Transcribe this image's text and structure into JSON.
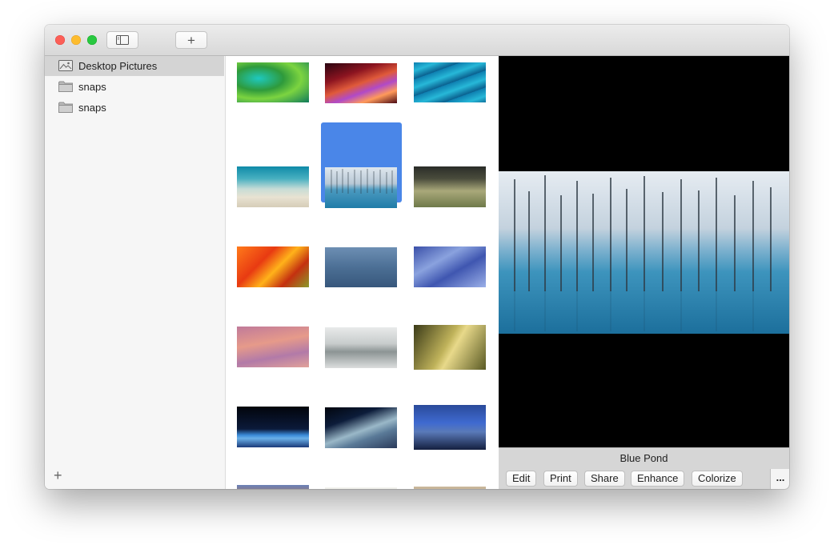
{
  "sidebar": {
    "items": [
      {
        "label": "Desktop Pictures",
        "icon": "photo-folder-icon",
        "selected": true
      },
      {
        "label": "snaps",
        "icon": "folder-icon",
        "selected": false
      },
      {
        "label": "snaps",
        "icon": "folder-icon",
        "selected": false
      }
    ],
    "add_label": "+"
  },
  "toolbar": {
    "add_label": "+"
  },
  "grid": {
    "selected_index": 4,
    "thumbnails": [
      {
        "name": "green-swirl-thumbnail"
      },
      {
        "name": "red-canyon-thumbnail"
      },
      {
        "name": "blue-waves-thumbnail"
      },
      {
        "name": "beach-thumbnail"
      },
      {
        "name": "blue-pond-thumbnail"
      },
      {
        "name": "grass-thumbnail"
      },
      {
        "name": "autumn-thumbnail"
      },
      {
        "name": "blue-texture-thumbnail"
      },
      {
        "name": "ice-thumbnail"
      },
      {
        "name": "sand-dunes-thumbnail"
      },
      {
        "name": "foggy-lake-thumbnail"
      },
      {
        "name": "golden-forest-thumbnail"
      },
      {
        "name": "earth-horizon-thumbnail"
      },
      {
        "name": "earth-orbit-thumbnail"
      },
      {
        "name": "mountain-night-thumbnail"
      },
      {
        "name": "el-capitan-thumbnail"
      },
      {
        "name": "elephant-thumbnail"
      },
      {
        "name": "beige-thumbnail"
      }
    ]
  },
  "preview": {
    "title": "Blue Pond",
    "buttons": [
      {
        "label": "Edit"
      },
      {
        "label": "Print"
      },
      {
        "label": "Share"
      },
      {
        "label": "Enhance"
      },
      {
        "label": "Colorize"
      }
    ],
    "more_label": "..."
  },
  "colors": {
    "selection": "#4a86e8",
    "sidebar_selected": "#d4d4d4"
  }
}
